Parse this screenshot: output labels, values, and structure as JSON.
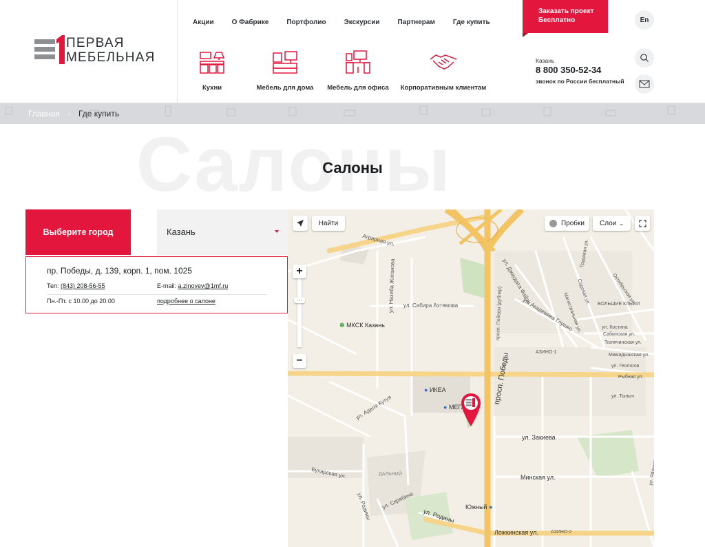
{
  "brand": {
    "line1": "ПЕРВАЯ",
    "line2": "МЕБЕЛЬНАЯ",
    "accent_color": "#e3173e"
  },
  "topnav": [
    "Акции",
    "О Фабрике",
    "Портфолио",
    "Экскурсии",
    "Партнерам",
    "Где купить"
  ],
  "cta": {
    "line1": "Заказать проект",
    "line2": "Бесплатно"
  },
  "lang_button": "En",
  "categories": [
    {
      "label": "Кухни",
      "icon": "kitchen-icon"
    },
    {
      "label": "Мебель для дома",
      "icon": "home-furniture-icon"
    },
    {
      "label": "Мебель для офиса",
      "icon": "office-furniture-icon"
    },
    {
      "label": "Корпоративным клиентам",
      "icon": "handshake-icon"
    }
  ],
  "contact": {
    "city": "Казань",
    "phone": "8 800 350-52-34",
    "note": "звонок по России бесплатный"
  },
  "breadcrumb": {
    "home": "Главная",
    "current": "Где купить"
  },
  "hero": {
    "background_word": "Салоны",
    "title": "Салоны"
  },
  "city_selector": {
    "label": "Выберите город",
    "selected": "Казань"
  },
  "salon": {
    "address": "пр. Победы, д. 139, корп. 1, пом. 1025",
    "phone_label": "Тел:",
    "phone": "(843) 208-56-55",
    "email_label": "E-mail:",
    "email": "a.zinovev@1mf.ru",
    "hours": "Пн.-Пт. с 10.00 до 20.00",
    "details_link": "подробнее о салоне"
  },
  "map": {
    "find_button": "Найти",
    "traffic_button": "Пробки",
    "layers_button": "Слои",
    "zoom_in": "+",
    "zoom_out": "−",
    "labels": {
      "agrarnaya": "Аграрная ул.",
      "mcks": "МКСК Казань",
      "sabira": "ул. Сабира Ахтямова",
      "nazib": "ул. Назиба Жиганова",
      "akad_glushko": "ул. Академика Глушко",
      "dzhaudat": "ул. Джаудата Файзи",
      "azino1": "АЗИНО-1",
      "bolshie_kliki": "БОЛЬШИЕ КЛЫКИ",
      "prosp_pobedy": "просп. Победы",
      "prosp_pobedy_dubler": "просп. Победы (дублер)",
      "ikea": "ИКЕА",
      "mega": "МЕГА",
      "zakieva": "ул. Закиева",
      "adelya": "ул. Аделя Кутуя",
      "minskaya": "Минская ул.",
      "dalniy": "ДАЛЬНИЙ",
      "buharskaya": "Бухарская ул.",
      "skryabina": "ул. Скрябина",
      "rodiny1": "ул. Родины",
      "rodiny2": "ул. Родины",
      "yuzhny": "Южный",
      "lozhkinskaya": "Ложкинская ул.",
      "azino2": "АЗИНО-2",
      "kostina": "ул. Костина",
      "sabinskaya": "Сабинская ул.",
      "tyulyachinskaya": "Тюлячинская ул.",
      "mamadysh": "Мамадышская ул.",
      "geologov": "ул. Геологов",
      "rybnaya": "Рыбная ул.",
      "tynych": "ул. Тыныч",
      "oktyabrskaya": "Октябрьская ул.",
      "sadovaya": "Садовая ул.",
      "trudovaya": "Трудовая ул.",
      "magistralnaya": "Магистральная ул.",
      "yafaroj": "ул. Яфарова"
    }
  }
}
